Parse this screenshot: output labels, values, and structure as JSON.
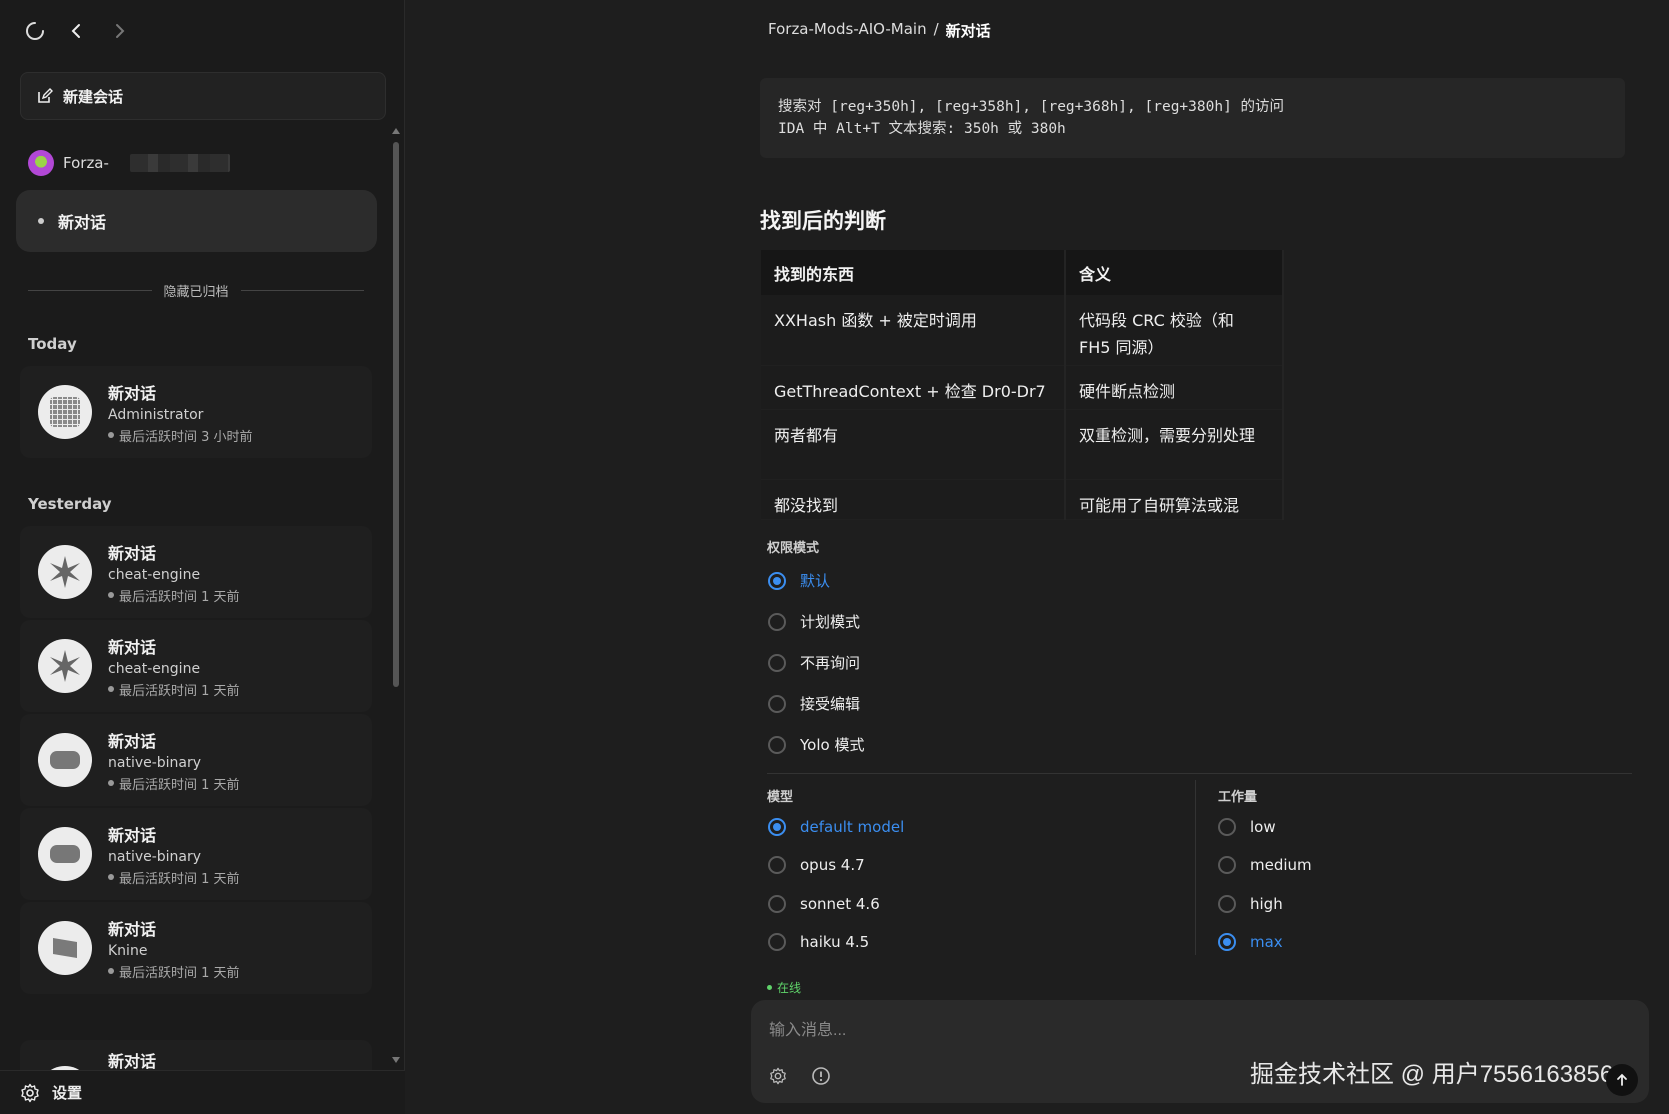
{
  "sidebar": {
    "new_chat_label": "新建会话",
    "project_name": "Forza-",
    "active_conversation": "新对话",
    "archive_toggle": "隐藏已归档",
    "groups": [
      {
        "label": "Today",
        "items": [
          {
            "title": "新对话",
            "subtitle": "Administrator",
            "meta": "最后活跃时间 3 小时前",
            "icon": "grid-icon"
          }
        ]
      },
      {
        "label": "Yesterday",
        "items": [
          {
            "title": "新对话",
            "subtitle": "cheat-engine",
            "meta": "最后活跃时间 1 天前",
            "icon": "starburst-icon"
          },
          {
            "title": "新对话",
            "subtitle": "cheat-engine",
            "meta": "最后活跃时间 1 天前",
            "icon": "starburst-icon"
          },
          {
            "title": "新对话",
            "subtitle": "native-binary",
            "meta": "最后活跃时间 1 天前",
            "icon": "pill-icon"
          },
          {
            "title": "新对话",
            "subtitle": "native-binary",
            "meta": "最后活跃时间 1 天前",
            "icon": "pill-icon"
          },
          {
            "title": "新对话",
            "subtitle": "Knine",
            "meta": "最后活跃时间 1 天前",
            "icon": "card-icon"
          },
          {
            "title": "新对话",
            "subtitle": "",
            "meta": "",
            "icon": "pill-icon"
          }
        ]
      }
    ],
    "settings_label": "设置"
  },
  "breadcrumb": {
    "project": "Forza-Mods-AIO-Main",
    "separator": "/",
    "current": "新对话"
  },
  "message": {
    "code_lines": [
      "搜索对 [reg+350h], [reg+358h], [reg+368h], [reg+380h] 的访问",
      "IDA 中 Alt+T 文本搜索: 350h 或 380h"
    ],
    "heading": "找到后的判断",
    "table": {
      "headers": [
        "找到的东西",
        "含义"
      ],
      "rows": [
        [
          "XXHash 函数 + 被定时调用",
          "代码段 CRC 校验（和 FH5 同源）"
        ],
        [
          "GetThreadContext + 检查 Dr0-Dr7",
          "硬件断点检测"
        ],
        [
          "两者都有",
          "双重检测，需要分别处理"
        ],
        [
          "都没找到",
          "可能用了自研算法或混"
        ]
      ]
    }
  },
  "permission": {
    "label": "权限模式",
    "options": [
      "默认",
      "计划模式",
      "不再询问",
      "接受编辑",
      "Yolo 模式"
    ],
    "selected": 0
  },
  "model": {
    "label": "模型",
    "options": [
      "default model",
      "opus 4.7",
      "sonnet 4.6",
      "haiku 4.5"
    ],
    "selected": 0
  },
  "effort": {
    "label": "工作量",
    "options": [
      "low",
      "medium",
      "high",
      "max"
    ],
    "selected": 3
  },
  "status": "在线",
  "composer": {
    "placeholder": "输入消息..."
  },
  "watermark": "掘金技术社区 @ 用户75561638568",
  "colors": {
    "accent": "#3b8ef0",
    "online": "#5fd36a",
    "background": "#1e1e1e"
  }
}
